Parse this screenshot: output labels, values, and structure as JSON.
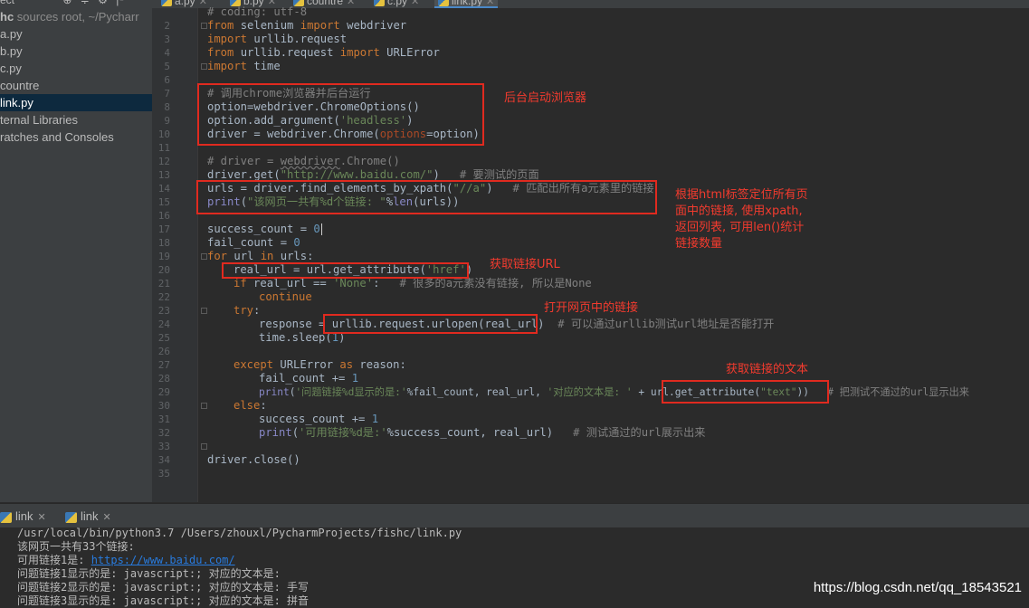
{
  "sidebar": {
    "header": [
      "ect",
      "⊕",
      "≑",
      "⚙",
      "|⁃"
    ],
    "root_name": "hc",
    "root_muted": " sources root, ~/Pycharr",
    "items": [
      "a.py",
      "b.py",
      "c.py",
      "countre",
      "link.py",
      "ternal Libraries",
      "ratches and Consoles"
    ]
  },
  "tabs": [
    {
      "label": "a.py"
    },
    {
      "label": "b.py"
    },
    {
      "label": "countre"
    },
    {
      "label": "c.py"
    },
    {
      "label": "link.py"
    }
  ],
  "line_numbers": [
    "2",
    "3",
    "4",
    "5",
    "6",
    "7",
    "8",
    "9",
    "10",
    "11",
    "12",
    "13",
    "14",
    "15",
    "16",
    "17",
    "18",
    "19",
    "20",
    "21",
    "22",
    "23",
    "24",
    "25",
    "26",
    "27",
    "28",
    "29",
    "30",
    "31",
    "32",
    "33",
    "34",
    "35"
  ],
  "code": {
    "l1_partial": "# coding: utf-8",
    "l2": [
      "from",
      " selenium ",
      "import",
      " webdriver"
    ],
    "l3": [
      "import",
      " urllib.request"
    ],
    "l4": [
      "from",
      " urllib.request ",
      "import",
      " URLError"
    ],
    "l5": [
      "import",
      " time"
    ],
    "l7": "# 调用chrome浏览器并后台运行",
    "l8": "option=webdriver.ChromeOptions()",
    "l9": [
      "option.add_argument(",
      "'headless'",
      ")"
    ],
    "l10": [
      "driver = webdriver.Chrome(",
      "options",
      "=option)"
    ],
    "l12": [
      "# driver = ",
      "webdriver",
      ".Chrome()"
    ],
    "l13": [
      "driver.get(",
      "\"http://www.baidu.com/\"",
      ")   ",
      "# 要测试的页面"
    ],
    "l14": [
      "urls = driver.find_elements_by_xpath(",
      "\"//a\"",
      ")   ",
      "# 匹配出所有a元素里的链接"
    ],
    "l15": [
      "print",
      "(",
      "\"该网页一共有%d个链接: \"",
      "%",
      "len",
      "(urls))"
    ],
    "l17": [
      "success_count = ",
      "0"
    ],
    "l18": [
      "fail_count = ",
      "0"
    ],
    "l19": [
      "for",
      " url ",
      "in",
      " urls:"
    ],
    "l20": [
      "real_url = url.get_attribute(",
      "'href'",
      ")"
    ],
    "l21": [
      "if",
      " real_url == ",
      "'None'",
      ":   ",
      "# 很多的a元素没有链接, 所以是None"
    ],
    "l22": "continue",
    "l23": [
      "try",
      ":"
    ],
    "l24": [
      "response = ",
      "urllib.request.urlopen(real_url)",
      "  ",
      "# 可以通过urllib测试url地址是否能打开"
    ],
    "l25": [
      "time.sleep(",
      "1",
      ")"
    ],
    "l27": [
      "except",
      " URLError ",
      "as",
      " reason:"
    ],
    "l28": [
      "fail_count += ",
      "1"
    ],
    "l29": [
      "print",
      "(",
      "'问题链接%d显示的是:'",
      "%fail_count, real_url, ",
      "'对应的文本是: '",
      " + ",
      "url.get_attribute(",
      "\"text\"",
      "))   ",
      "# 把测试不通过的url显示出来"
    ],
    "l30": [
      "else",
      ":"
    ],
    "l31": [
      "success_count += ",
      "1"
    ],
    "l32": [
      "print",
      "(",
      "'可用链接%d是:'",
      "%success_count, real_url)   ",
      "# 测试通过的url展示出来"
    ],
    "l34": "driver.close()"
  },
  "annotations": {
    "a1": "后台启动浏览器",
    "a2_lines": [
      "根据html标签定位所有页",
      "面中的链接, 使用xpath,",
      "返回列表, 可用len()统计",
      "链接数量"
    ],
    "a3": "获取链接URL",
    "a4": "打开网页中的链接",
    "a5": "获取链接的文本"
  },
  "run_tabs": [
    {
      "label": "link"
    },
    {
      "label": "link"
    }
  ],
  "console": {
    "line1": "/usr/local/bin/python3.7 /Users/zhouxl/PycharmProjects/fishc/link.py",
    "line2": "该网页一共有33个链接:",
    "line3_prefix": "可用链接1是: ",
    "line3_link": "https://www.baidu.com/",
    "line4": "问题链接1显示的是: javascript:; 对应的文本是:",
    "line5": "问题链接2显示的是: javascript:; 对应的文本是: 手写",
    "line6": "问题链接3显示的是: javascript:; 对应的文本是: 拼音"
  },
  "watermark": "https://blog.csdn.net/qq_18543521",
  "colors": {
    "accent": "#e02a1f",
    "link": "#287bde",
    "keyword": "#cc7832",
    "string": "#6a8759"
  }
}
